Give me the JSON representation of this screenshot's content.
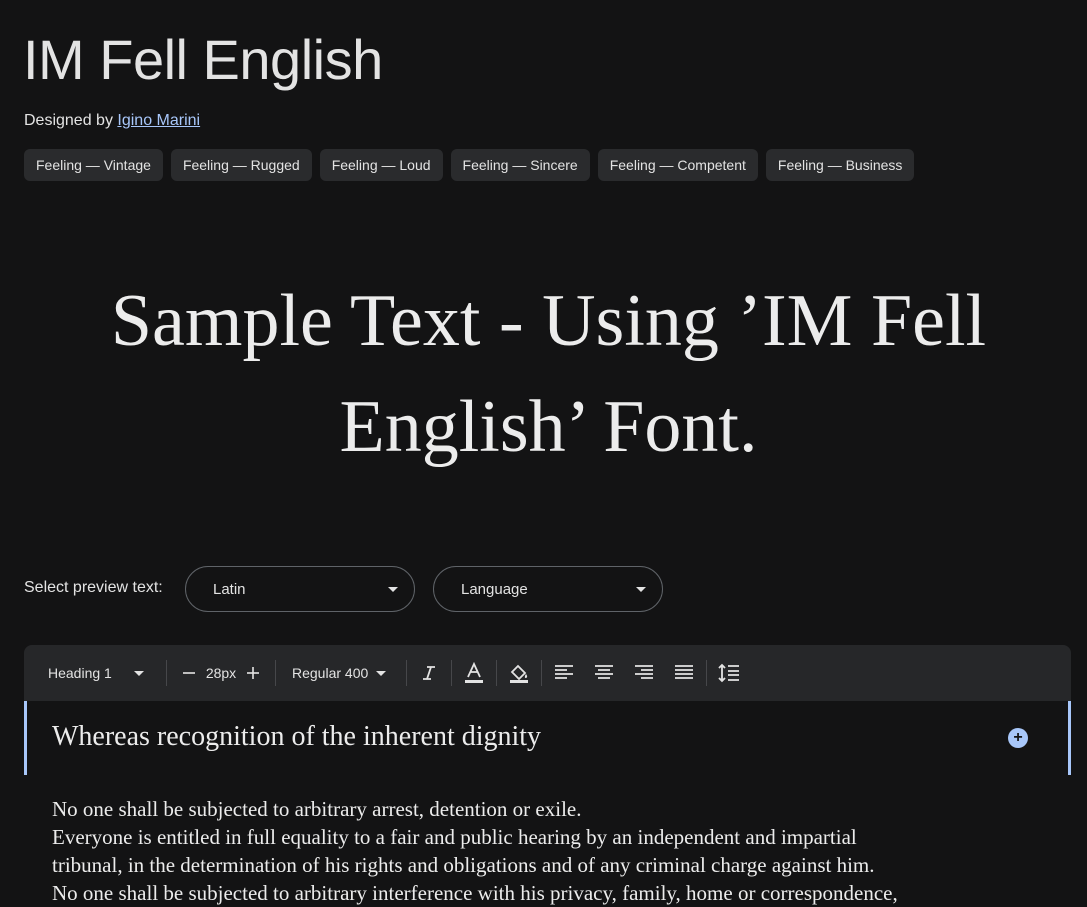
{
  "font": {
    "title": "IM Fell English",
    "designed_by_label": "Designed by",
    "designer": "Igino Marini"
  },
  "tags": [
    "Feeling — Vintage",
    "Feeling — Rugged",
    "Feeling — Loud",
    "Feeling — Sincere",
    "Feeling — Competent",
    "Feeling — Business"
  ],
  "sample": {
    "line1": "Sample Text - Using ’IM Fell",
    "line2": "English’ Font."
  },
  "preview": {
    "label": "Select preview text:",
    "script_value": "Latin",
    "language_value": "Language"
  },
  "toolbar": {
    "style_value": "Heading 1",
    "size_value": "28px",
    "weight_value": "Regular 400"
  },
  "editor": {
    "heading": "Whereas recognition of the inherent dignity",
    "paragraph": [
      "No one shall be subjected to arbitrary arrest, detention or exile.",
      "Everyone is entitled in full equality to a fair and public hearing by an independent and impartial",
      "tribunal, in the determination of his rights and obligations and of any criminal charge against him.",
      "No one shall be subjected to arbitrary interference with his privacy, family, home or correspondence,"
    ]
  },
  "colors": {
    "background": "#131314",
    "accent": "#a8c7fa",
    "chip": "#2a2b2d",
    "toolbar": "#262729"
  }
}
